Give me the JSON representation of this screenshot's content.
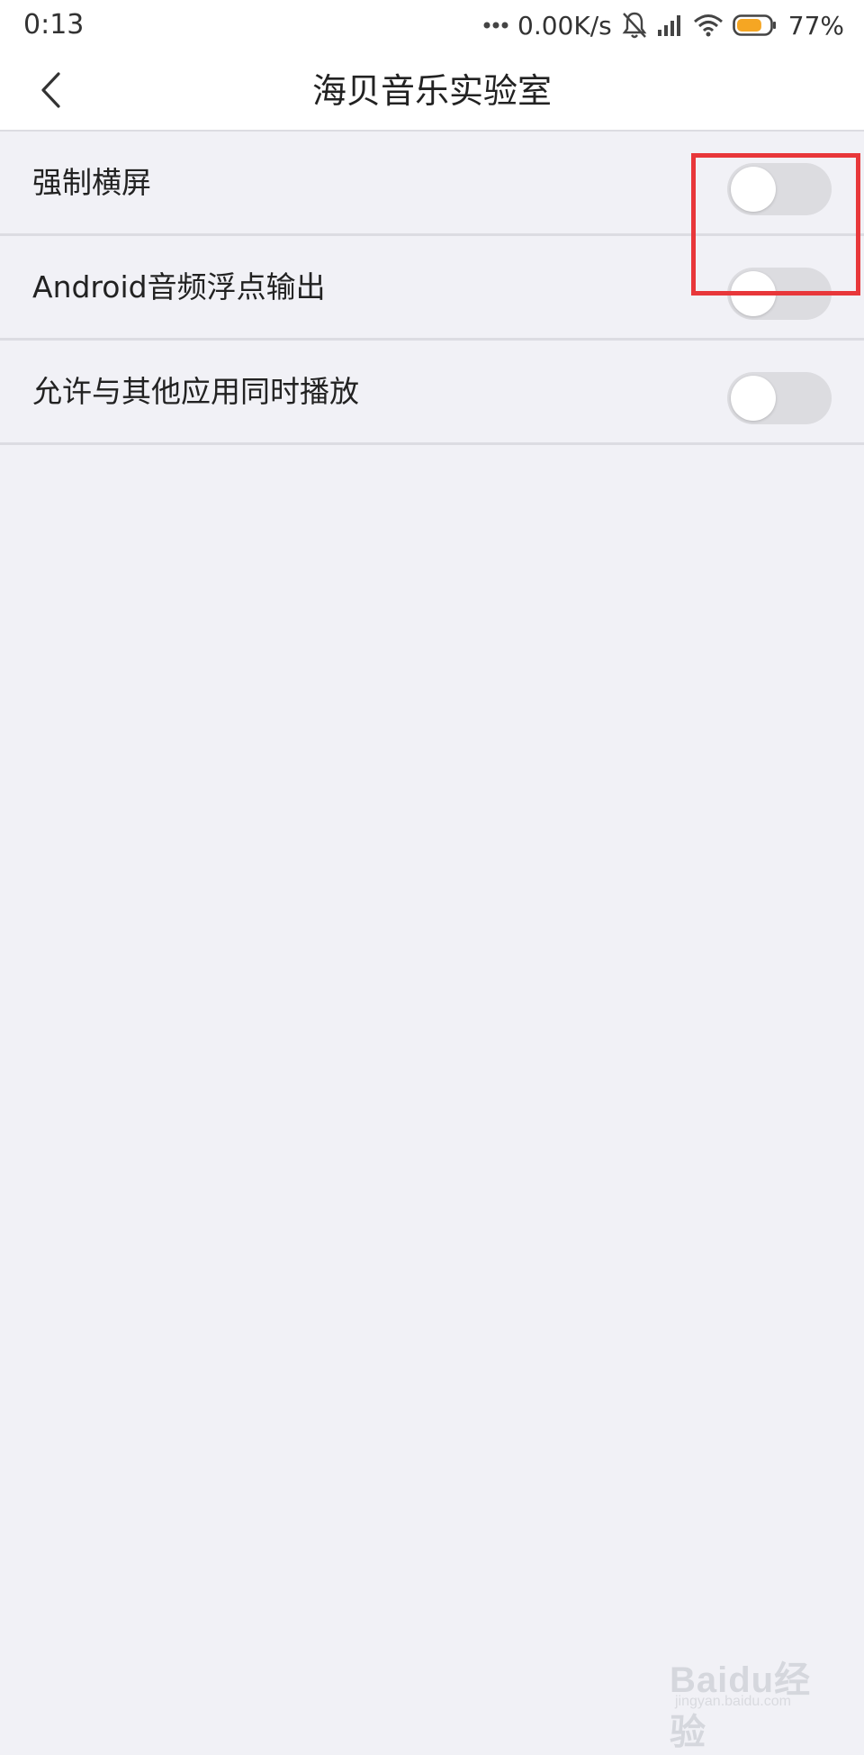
{
  "status_bar": {
    "time": "0:13",
    "network_speed": "0.00K/s",
    "battery_percent": "77%",
    "battery_level": 0.77,
    "battery_color": "#f5a623",
    "icons": [
      "more-dots-icon",
      "bell-muted-icon",
      "signal-bars-icon",
      "wifi-icon",
      "battery-icon"
    ]
  },
  "nav": {
    "back_icon": "chevron-left-icon",
    "title": "海贝音乐实验室"
  },
  "settings": [
    {
      "label": "强制横屏",
      "enabled": false
    },
    {
      "label": "Android音频浮点输出",
      "enabled": false
    },
    {
      "label": "允许与其他应用同时播放",
      "enabled": false
    }
  ],
  "highlight": {
    "color": "#e8373a",
    "target": "settings.0.toggle"
  },
  "watermark": {
    "text": "Baidu经验",
    "sub": "jingyan.baidu.com"
  }
}
